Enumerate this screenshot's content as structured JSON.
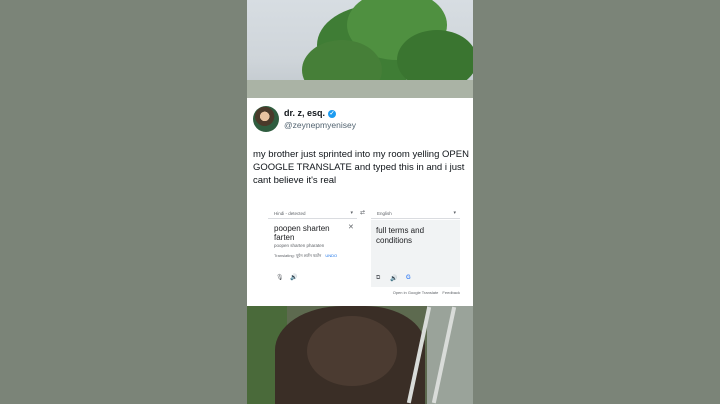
{
  "tweet": {
    "display_name": "dr. z, esq.",
    "handle": "@zeynepmyenisey",
    "text": "my brother just sprinted into my room yelling OPEN GOOGLE TRANSLATE and typed this in and i just cant believe it's real"
  },
  "translate": {
    "source_lang": "Hindi - detected",
    "target_lang": "English",
    "source_text": "poopen sharten farten",
    "transliteration": "poopen sharten pharaten",
    "translating_label": "Translating:",
    "translating_word": "पूपेन शार्टेन फार्टेन",
    "translating_lang": "UNDO",
    "target_text": "full terms and conditions",
    "footer_open": "Open in Google Translate",
    "footer_feedback": "Feedback"
  },
  "icons": {
    "swap": "⇄",
    "close": "✕",
    "mic": "🎙",
    "speaker": "🔊",
    "copy": "⧉",
    "google": "G",
    "verified": "✓",
    "dropdown": "▾"
  },
  "colors": {
    "verified_blue": "#1d9bf0",
    "link_blue": "#1a73e8",
    "text_dark": "#0f1419",
    "text_muted": "#536471"
  }
}
